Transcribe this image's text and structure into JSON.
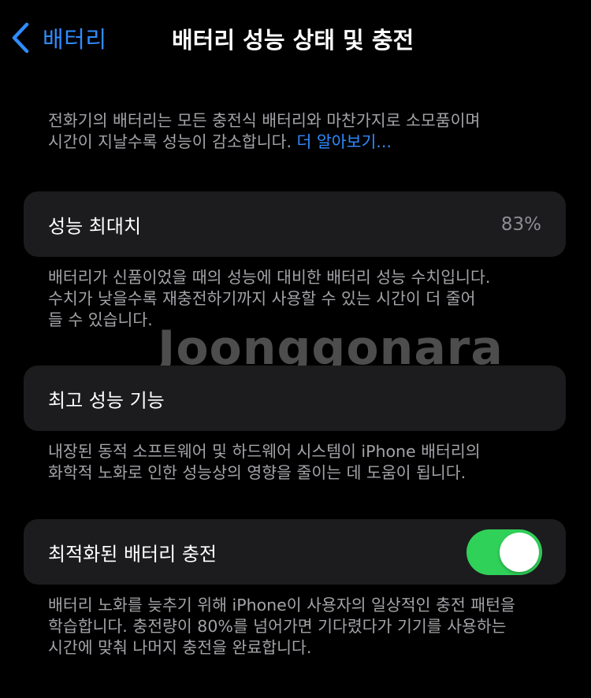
{
  "nav": {
    "back_label": "배터리",
    "title": "배터리 성능 상태 및 충전"
  },
  "intro": {
    "line1": "전화기의 배터리는 모든 충전식 배터리와 마찬가지로 소모품이며",
    "line2_text": "시간이 지날수록 성능이 감소합니다. ",
    "learn_more": "더 알아보기..."
  },
  "max_capacity": {
    "label": "성능 최대치",
    "value": "83%",
    "footnote": [
      "배터리가 신품이었을 때의 성능에 대비한 배터리 성능 수치입니다.",
      "수치가 낮을수록 재충전하기까지 사용할 수 있는 시간이 더 줄어",
      "들 수 있습니다."
    ]
  },
  "peak_performance": {
    "label": "최고 성능 기능",
    "footnote": [
      "내장된 동적 소프트웨어 및 하드웨어 시스템이 iPhone 배터리의",
      "화학적 노화로 인한 성능상의 영향을 줄이는 데 도움이 됩니다."
    ]
  },
  "optimized_charging": {
    "label": "최적화된 배터리 충전",
    "enabled": true,
    "footnote": [
      "배터리 노화를 늦추기 위해 iPhone이 사용자의 일상적인 충전 패턴을",
      "학습합니다. 충전량이 80%를 넘어가면 기다렸다가 기기를 사용하는",
      "시간에 맞춰 나머지 충전을 완료합니다."
    ]
  },
  "watermark": "Joonggonara",
  "colors": {
    "accent": "#2f8cff",
    "toggle_on": "#30d158",
    "cell_bg": "#1c1c1e",
    "background": "#000000"
  },
  "icons": {
    "back": "chevron-left-icon"
  }
}
